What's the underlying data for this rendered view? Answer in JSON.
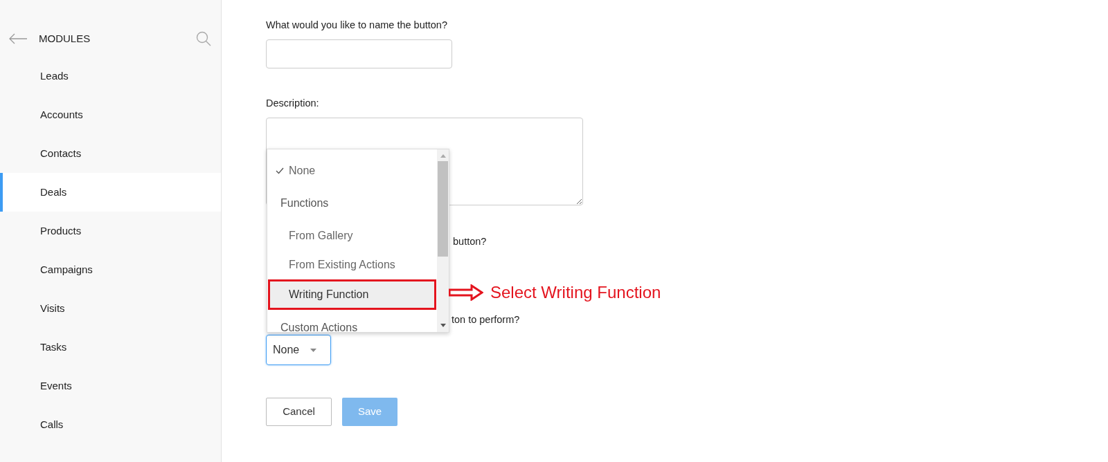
{
  "sidebar": {
    "title": "MODULES",
    "items": [
      {
        "label": "Leads",
        "selected": false
      },
      {
        "label": "Accounts",
        "selected": false
      },
      {
        "label": "Contacts",
        "selected": false
      },
      {
        "label": "Deals",
        "selected": true
      },
      {
        "label": "Products",
        "selected": false
      },
      {
        "label": "Campaigns",
        "selected": false
      },
      {
        "label": "Visits",
        "selected": false
      },
      {
        "label": "Tasks",
        "selected": false
      },
      {
        "label": "Events",
        "selected": false
      },
      {
        "label": "Calls",
        "selected": false
      }
    ]
  },
  "form": {
    "name_label": "What would you like to name the button?",
    "description_label": "Description:",
    "partial_label_1": "button?",
    "partial_label_2": "ton to perform?",
    "action_select": {
      "value": "None"
    },
    "buttons": [
      {
        "label": "Cancel",
        "disabled": false
      },
      {
        "label": "Save",
        "disabled": true
      }
    ]
  },
  "dropdown": {
    "options": [
      {
        "kind": "option",
        "label": "None",
        "checked": true,
        "highlighted": false
      },
      {
        "kind": "group",
        "label": "Functions"
      },
      {
        "kind": "option",
        "label": "From Gallery",
        "checked": false,
        "highlighted": false
      },
      {
        "kind": "option",
        "label": "From Existing Actions",
        "checked": false,
        "highlighted": false
      },
      {
        "kind": "option",
        "label": "Writing Function",
        "checked": false,
        "highlighted": true
      },
      {
        "kind": "group",
        "label": "Custom Actions"
      }
    ]
  },
  "annotation": {
    "text": "Select Writing Function"
  }
}
